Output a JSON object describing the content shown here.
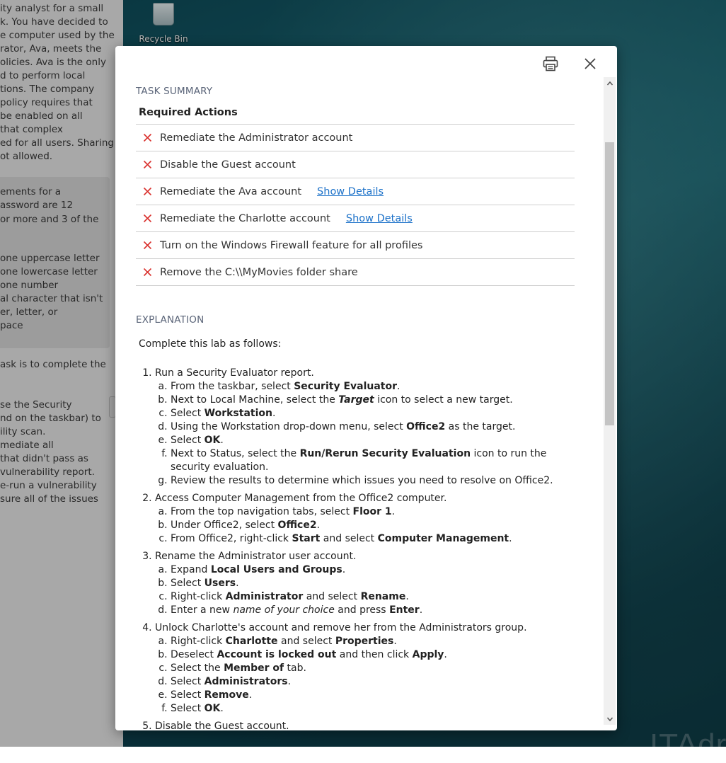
{
  "left_panel": {
    "fragments": [
      "ity analyst for a small",
      "k. You have decided to",
      "e computer used by the",
      "rator, Ava, meets the",
      "olicies. Ava is the only",
      "d to perform local",
      "tions. The company",
      "policy requires that",
      "be enabled on all",
      "that complex",
      "ed for all users. Sharing",
      "ot allowed.",
      "ements for a",
      "assword are 12",
      " or more and 3 of the",
      " one uppercase letter",
      " one lowercase letter",
      " one number",
      "al character that isn't",
      "er, letter, or",
      "pace",
      "ask is to complete the",
      "se the Security",
      "nd on the taskbar) to",
      "ility scan.",
      "mediate all",
      "that didn't pass as",
      "vulnerability report.",
      "e-run a vulnerability",
      "sure all of the issues"
    ]
  },
  "desktop": {
    "recycle_bin_label": "Recycle Bin",
    "watermark": "ITAdr"
  },
  "modal": {
    "task_summary_title": "TASK SUMMARY",
    "required_actions_title": "Required Actions",
    "required_actions": [
      {
        "label": "Remediate the Administrator account",
        "details": ""
      },
      {
        "label": "Disable the Guest account",
        "details": ""
      },
      {
        "label": "Remediate the Ava account",
        "details": "Show Details"
      },
      {
        "label": "Remediate the Charlotte account",
        "details": "Show Details"
      },
      {
        "label": "Turn on the Windows Firewall feature for all profiles",
        "details": ""
      },
      {
        "label": "Remove the C:\\\\MyMovies folder share",
        "details": ""
      }
    ],
    "explanation_title": "EXPLANATION",
    "explanation_intro": "Complete this lab as follows:",
    "steps": [
      {
        "title": "Run a Security Evaluator report.",
        "sub": [
          [
            {
              "t": "From the taskbar, select "
            },
            {
              "t": "Security Evaluator",
              "b": true
            },
            {
              "t": "."
            }
          ],
          [
            {
              "t": "Next to Local Machine, select the "
            },
            {
              "t": "Target",
              "b": true,
              "i": true
            },
            {
              "t": " icon to select a new target."
            }
          ],
          [
            {
              "t": "Select "
            },
            {
              "t": "Workstation",
              "b": true
            },
            {
              "t": "."
            }
          ],
          [
            {
              "t": "Using the Workstation drop-down menu, select "
            },
            {
              "t": "Office2",
              "b": true
            },
            {
              "t": " as the target."
            }
          ],
          [
            {
              "t": "Select "
            },
            {
              "t": "OK",
              "b": true
            },
            {
              "t": "."
            }
          ],
          [
            {
              "t": "Next to Status, select the "
            },
            {
              "t": "Run/Rerun Security Evaluation",
              "b": true
            },
            {
              "t": " icon to run the security evaluation."
            }
          ],
          [
            {
              "t": "Review the results to determine which issues you need to resolve on Office2."
            }
          ]
        ]
      },
      {
        "title": "Access Computer Management from the Office2 computer.",
        "sub": [
          [
            {
              "t": "From the top navigation tabs, select "
            },
            {
              "t": "Floor 1",
              "b": true
            },
            {
              "t": "."
            }
          ],
          [
            {
              "t": "Under Office2, select "
            },
            {
              "t": "Office2",
              "b": true
            },
            {
              "t": "."
            }
          ],
          [
            {
              "t": "From Office2, right-click "
            },
            {
              "t": "Start",
              "b": true
            },
            {
              "t": " and select "
            },
            {
              "t": "Computer Management",
              "b": true
            },
            {
              "t": "."
            }
          ]
        ]
      },
      {
        "title": "Rename the Administrator user account.",
        "sub": [
          [
            {
              "t": "Expand "
            },
            {
              "t": "Local Users and Groups",
              "b": true
            },
            {
              "t": "."
            }
          ],
          [
            {
              "t": "Select "
            },
            {
              "t": "Users",
              "b": true
            },
            {
              "t": "."
            }
          ],
          [
            {
              "t": "Right-click "
            },
            {
              "t": "Administrator",
              "b": true
            },
            {
              "t": " and select "
            },
            {
              "t": "Rename",
              "b": true
            },
            {
              "t": "."
            }
          ],
          [
            {
              "t": "Enter a new "
            },
            {
              "t": "name of your choice",
              "i": true
            },
            {
              "t": " and press "
            },
            {
              "t": "Enter",
              "b": true
            },
            {
              "t": "."
            }
          ]
        ]
      },
      {
        "title": "Unlock Charlotte's account and remove her from the Administrators group.",
        "sub": [
          [
            {
              "t": "Right-click "
            },
            {
              "t": "Charlotte",
              "b": true
            },
            {
              "t": " and select "
            },
            {
              "t": "Properties",
              "b": true
            },
            {
              "t": "."
            }
          ],
          [
            {
              "t": "Deselect "
            },
            {
              "t": "Account is locked out",
              "b": true
            },
            {
              "t": " and then click "
            },
            {
              "t": "Apply",
              "b": true
            },
            {
              "t": "."
            }
          ],
          [
            {
              "t": "Select the "
            },
            {
              "t": "Member of",
              "b": true
            },
            {
              "t": " tab."
            }
          ],
          [
            {
              "t": "Select "
            },
            {
              "t": "Administrators",
              "b": true
            },
            {
              "t": "."
            }
          ],
          [
            {
              "t": "Select "
            },
            {
              "t": "Remove",
              "b": true
            },
            {
              "t": "."
            }
          ],
          [
            {
              "t": "Select "
            },
            {
              "t": "OK",
              "b": true
            },
            {
              "t": "."
            }
          ]
        ]
      },
      {
        "title": "Disable the Guest account.",
        "sub": []
      }
    ]
  },
  "colors": {
    "fail_x": "#d9302c",
    "link": "#1d72c9",
    "section_title": "#5a6478"
  },
  "icons": {
    "print": "printer-icon",
    "close": "close-icon",
    "fail": "x-mark-icon"
  }
}
